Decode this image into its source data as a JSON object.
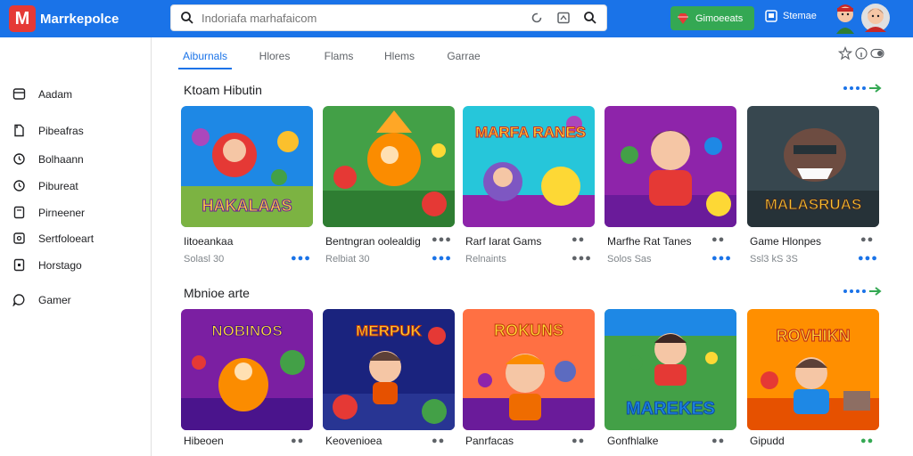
{
  "app": {
    "logo_letter": "M",
    "title": "Marrkepolce"
  },
  "search": {
    "placeholder": "Indoriafa marhafaicom"
  },
  "header": {
    "green_button": "Gimoeeats",
    "user_label": "Stemae"
  },
  "sidebar": {
    "items": [
      {
        "label": "Aadam",
        "icon": "window-icon"
      },
      {
        "label": "Pibeafras",
        "icon": "document-icon"
      },
      {
        "label": "Bolhaann",
        "icon": "clock-icon"
      },
      {
        "label": "Pibureat",
        "icon": "clock-icon"
      },
      {
        "label": "Pirneener",
        "icon": "page-icon"
      },
      {
        "label": "Sertfoloeart",
        "icon": "settings-icon"
      },
      {
        "label": "Horstago",
        "icon": "bookmark-icon"
      },
      {
        "label": "Gamer",
        "icon": "chat-icon"
      }
    ]
  },
  "tabs": [
    "Aiburnals",
    "Hlores",
    "Flams",
    "Hlems",
    "Garrae"
  ],
  "sections": [
    {
      "title": "Ktoam Hibutin",
      "cards": [
        {
          "title": "Iitoeankaa",
          "subtitle": "Solasl 30",
          "art": "HAKALAAS"
        },
        {
          "title": "Bentngran oolealdig",
          "subtitle": "Relbiat 30",
          "art": ""
        },
        {
          "title": "Rarf Iarat Gams",
          "subtitle": "Relnaints",
          "art": "MARFA RANES"
        },
        {
          "title": "Marfhe Rat Tanes",
          "subtitle": "Solos Sas",
          "art": ""
        },
        {
          "title": "Game Hlonpes",
          "subtitle": "Ssl3 kS 3S",
          "art": "MALASRUAS"
        }
      ]
    },
    {
      "title": "Mbnioe arte",
      "cards": [
        {
          "title": "Hibeoen",
          "subtitle": "",
          "art": "NOBINOS"
        },
        {
          "title": "Keovenioea",
          "subtitle": "",
          "art": "MERPUK"
        },
        {
          "title": "Panrfacas",
          "subtitle": "",
          "art": "ROKUNS"
        },
        {
          "title": "Gonfhlalke",
          "subtitle": "",
          "art": "MAREKES"
        },
        {
          "title": "Gipudd",
          "subtitle": "",
          "art": "ROVHIKN"
        }
      ]
    }
  ],
  "colors": {
    "topbar": "#1a73e8",
    "accent": "#1a73e8",
    "green": "#34a853",
    "logo": "#e53935"
  }
}
